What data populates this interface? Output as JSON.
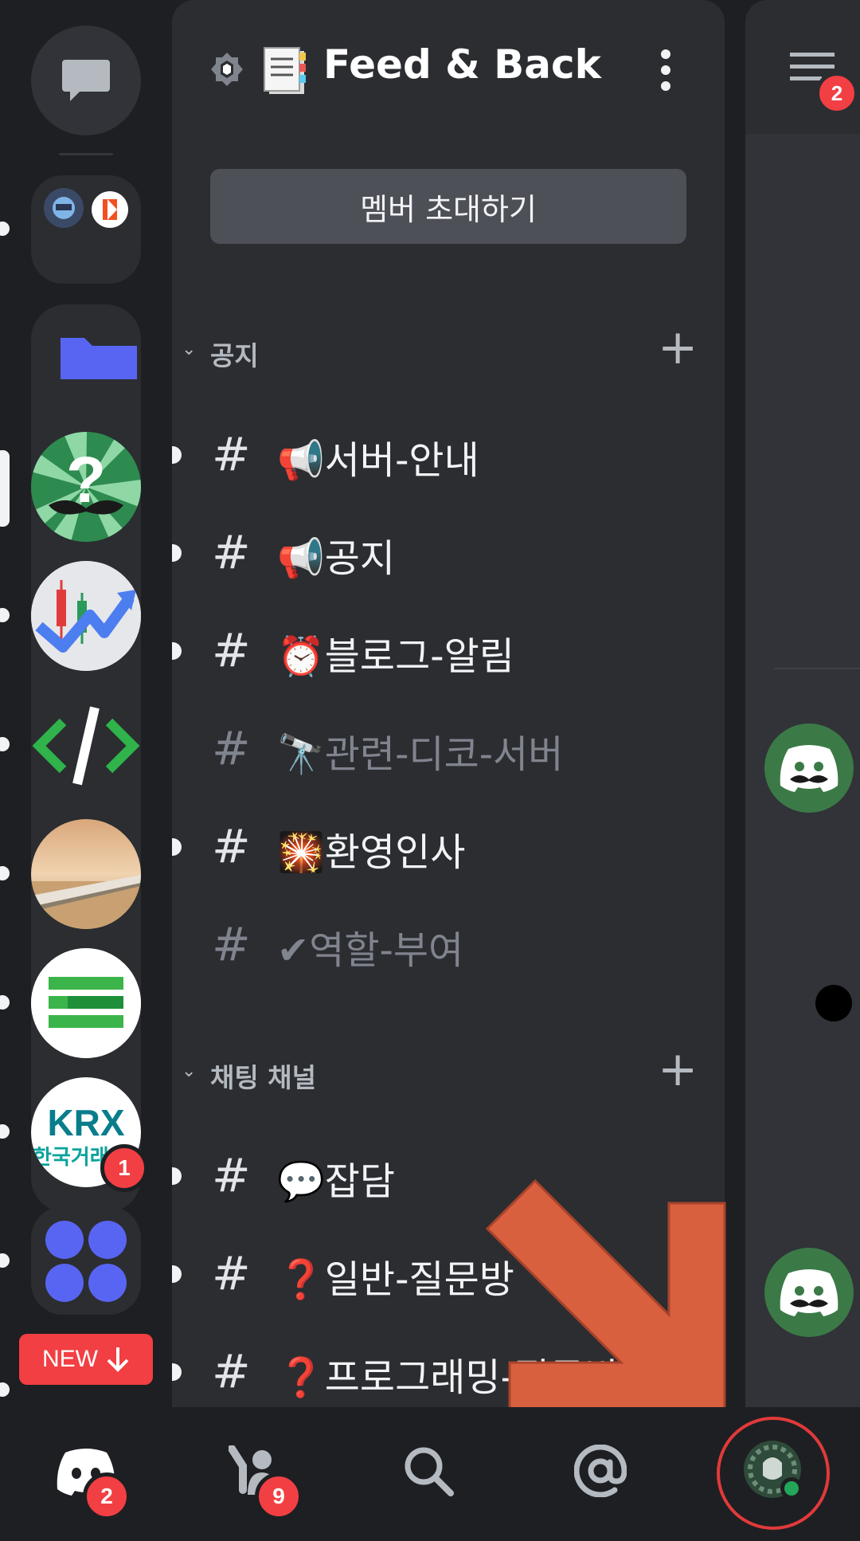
{
  "server": {
    "name": "Feed & Back",
    "invite_label": "멤버 초대하기"
  },
  "categories": [
    {
      "label": "공지",
      "channels": [
        {
          "emoji": "📢",
          "name": "서버-안내",
          "unread": true
        },
        {
          "emoji": "📢",
          "name": "공지",
          "unread": true
        },
        {
          "emoji": "⏰",
          "name": "블로그-알림",
          "unread": true
        },
        {
          "emoji": "🔭",
          "name": "관련-디코-서버",
          "unread": false
        },
        {
          "emoji": "🎇",
          "name": "환영인사",
          "unread": true
        },
        {
          "emoji": "✔",
          "name": "역할-부여",
          "unread": false
        }
      ]
    },
    {
      "label": "채팅 채널",
      "channels": [
        {
          "emoji": "💬",
          "name": "잡담",
          "unread": true
        },
        {
          "emoji": "❓",
          "name": "일반-질문방",
          "unread": true
        },
        {
          "emoji": "❓",
          "name": "프로그래밍-질문방",
          "unread": true
        }
      ]
    }
  ],
  "rail": {
    "krx_text_top": "KRX",
    "krx_text_bottom": "한국거래",
    "krx_badge": "1",
    "new_button": "NEW"
  },
  "peek": {
    "menu_badge": "2"
  },
  "bottom_nav": {
    "home_badge": "2",
    "friends_badge": "9"
  },
  "colors": {
    "accent": "#5865f2",
    "danger": "#f23f43",
    "arrow": "#d9603f",
    "online": "#23a55a"
  }
}
